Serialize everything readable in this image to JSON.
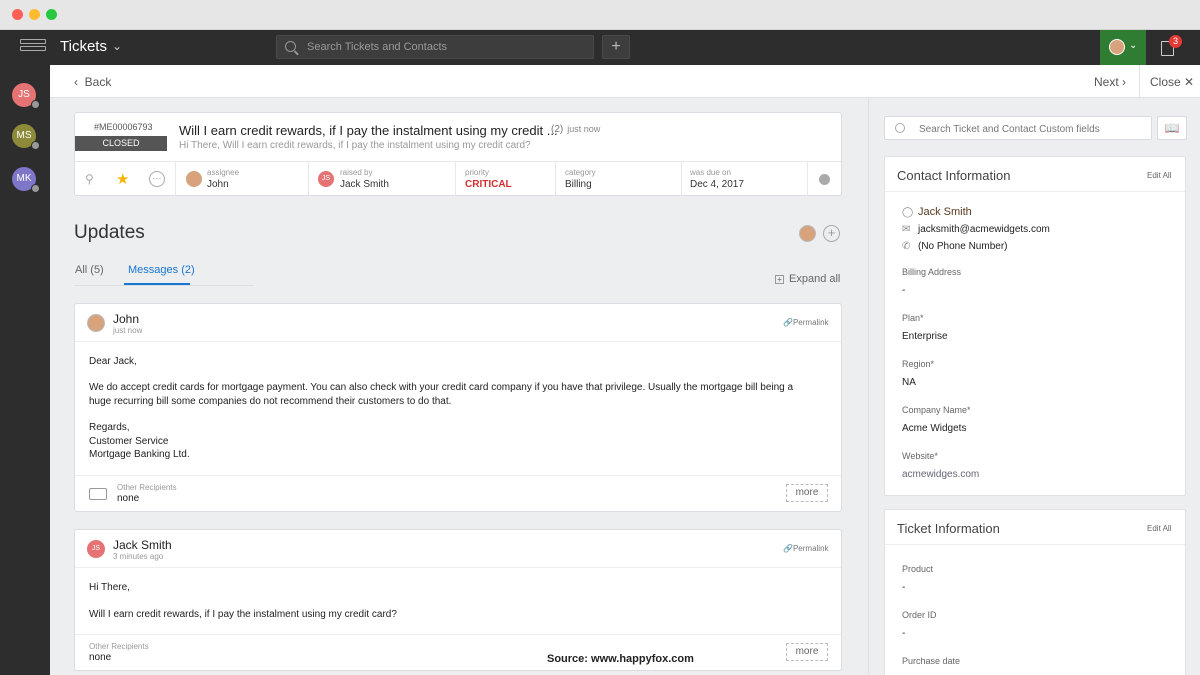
{
  "app": {
    "title": "Tickets",
    "search_placeholder": "Search Tickets and Contacts",
    "notif_count": "3",
    "colors": {
      "topbar": "#2d2d2d",
      "user_menu": "#2e7d32",
      "accent": "#1976d2",
      "critical": "#d32f2f"
    }
  },
  "rail": {
    "agents": [
      {
        "initials": "JS",
        "color": "#e57373"
      },
      {
        "initials": "MS",
        "color": "#8d8b3a"
      },
      {
        "initials": "MK",
        "color": "#7e77c9"
      }
    ]
  },
  "nav": {
    "back": "Back",
    "next": "Next",
    "close": "Close"
  },
  "ticket": {
    "id": "#ME00006793",
    "status": "CLOSED",
    "title": "Will I earn credit rewards, if I pay the instalment using my credit ...",
    "count": "(2)",
    "time": "just now",
    "preview": "Hi There, Will I earn credit rewards, if I pay the instalment using my credit card?",
    "props": {
      "assignee_label": "assignee",
      "assignee": "John",
      "raised_label": "raised by",
      "raised_by": "Jack Smith",
      "priority_label": "priority",
      "priority": "CRITICAL",
      "category_label": "category",
      "category": "Billing",
      "due_label": "was due on",
      "due": "Dec 4, 2017"
    }
  },
  "updates": {
    "heading": "Updates",
    "tab_all": "All (5)",
    "tab_messages": "Messages (2)",
    "expand_all": "Expand all",
    "messages": [
      {
        "name": "John",
        "time": "just now",
        "permalink": "Permalink",
        "body": [
          "Dear Jack,",
          "We do accept credit cards for mortgage payment. You can also check with your credit card company if you have that privilege. Usually the mortgage bill being a",
          "huge recurring bill some companies do not recommend their customers to do that.",
          "Regards,",
          "Customer Service",
          "Mortgage Banking Ltd."
        ],
        "recipients_label": "Other Recipients",
        "recipients": "none",
        "more": "more"
      },
      {
        "name": "Jack Smith",
        "time": "3 minutes ago",
        "permalink": "Permalink",
        "body": [
          "Hi There,",
          "Will I earn credit rewards, if I pay the instalment using my credit card?"
        ],
        "recipients_label": "Other Recipients",
        "recipients": "none",
        "more": "more"
      }
    ],
    "source": "Source: www.happyfox.com"
  },
  "sidebar": {
    "search_placeholder": "Search Ticket and Contact Custom fields",
    "contact": {
      "heading": "Contact Information",
      "edit": "Edit All",
      "name": "Jack Smith",
      "email": "jacksmith@acmewidgets.com",
      "phone": "(No Phone Number)",
      "fields": [
        {
          "label": "Billing Address",
          "value": "-"
        },
        {
          "label": "Plan*",
          "value": "Enterprise"
        },
        {
          "label": "Region*",
          "value": "NA"
        },
        {
          "label": "Company Name*",
          "value": "Acme Widgets"
        },
        {
          "label": "Website*",
          "value": "acmewidges.com"
        }
      ]
    },
    "ticket_info": {
      "heading": "Ticket Information",
      "edit": "Edit All",
      "fields": [
        {
          "label": "Product",
          "value": "-"
        },
        {
          "label": "Order ID",
          "value": "-"
        },
        {
          "label": "Purchase date",
          "value": ""
        }
      ]
    }
  }
}
